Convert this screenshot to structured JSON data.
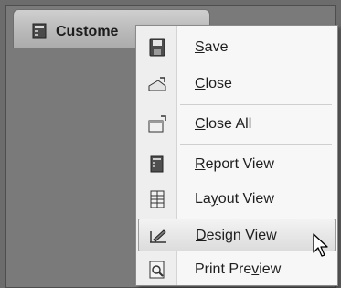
{
  "document_tab": {
    "label": "Custome",
    "icon": "form-icon"
  },
  "context_menu": {
    "items": [
      {
        "label": "Save",
        "mnemonic": "S",
        "icon": "save-disk-icon"
      },
      {
        "label": "Close",
        "mnemonic": "C",
        "icon": "close-document-icon"
      },
      {
        "label": "Close All",
        "mnemonic": "C",
        "icon": "close-all-icon"
      },
      {
        "label": "Report View",
        "mnemonic": "R",
        "icon": "report-view-icon"
      },
      {
        "label": "Layout View",
        "mnemonic": "y",
        "icon": "layout-view-icon"
      },
      {
        "label": "Design View",
        "mnemonic": "D",
        "icon": "design-view-icon",
        "highlighted": true
      },
      {
        "label": "Print Preview",
        "mnemonic": "v",
        "icon": "print-preview-icon"
      }
    ]
  },
  "cursor": {
    "icon": "mouse-pointer-icon"
  }
}
